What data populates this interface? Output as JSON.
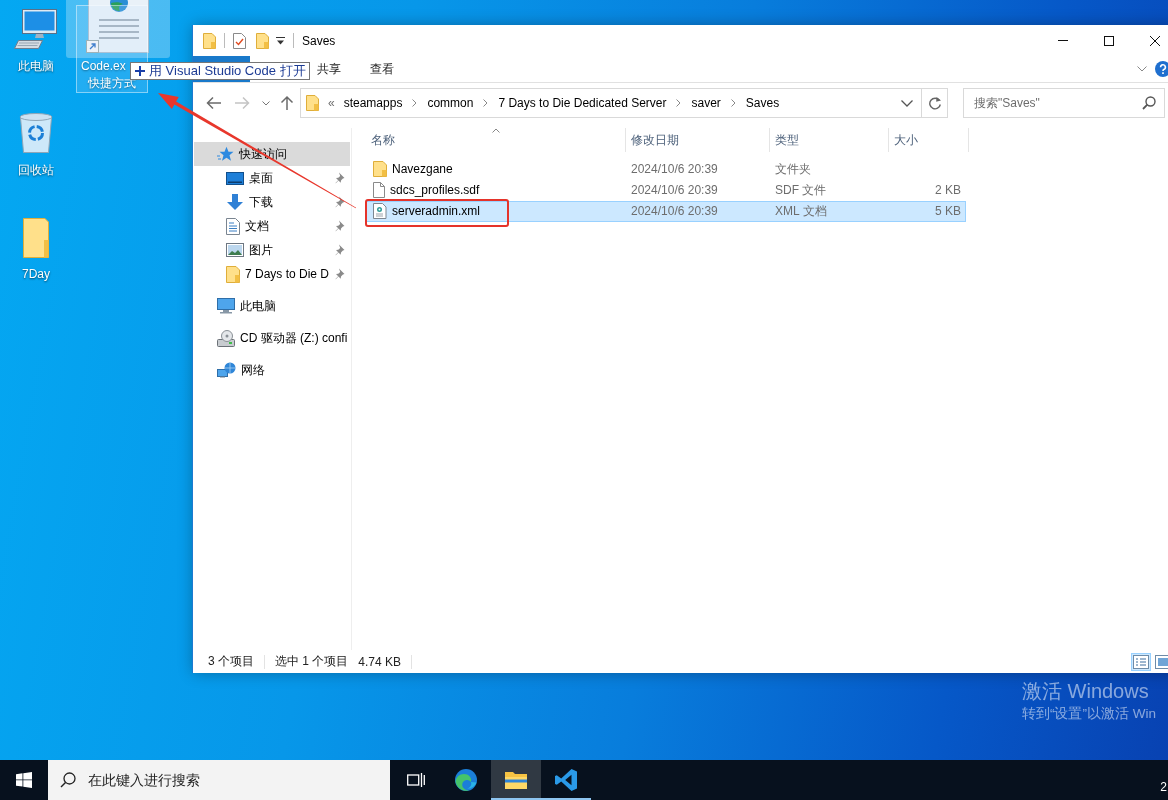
{
  "desktop": {
    "icons": [
      {
        "kind": "computer",
        "label": "此电脑"
      },
      {
        "kind": "recycle-bin",
        "label": "回收站"
      },
      {
        "kind": "folder",
        "label": "7Day"
      }
    ],
    "drag_item": {
      "label_lines": [
        "Code.ex",
        "快捷方式"
      ],
      "tooltip": "用 Visual Studio Code 打开"
    },
    "activation": {
      "title": "激活 Windows",
      "hint": "转到“设置”以激活 Win"
    }
  },
  "explorer": {
    "title": "Saves",
    "ribbon_tabs": [
      {
        "label": "共享",
        "selected": false
      },
      {
        "label": "查看",
        "selected": false
      }
    ],
    "history": {
      "can_go_back": true,
      "can_go_forward": false
    },
    "address": {
      "overflow": "«",
      "crumbs": [
        "steamapps",
        "common",
        "7 Days to Die Dedicated Server",
        "saver",
        "Saves"
      ]
    },
    "search": {
      "placeholder": "搜索\"Saves\""
    },
    "nav": [
      {
        "kind": "quick-access",
        "label": "快速访问",
        "selected": true,
        "children": [
          {
            "kind": "desktop",
            "label": "桌面",
            "pinned": true,
            "selected": false
          },
          {
            "kind": "download",
            "label": "下载",
            "pinned": true,
            "selected": false
          },
          {
            "kind": "documents",
            "label": "文档",
            "pinned": true,
            "selected": false
          },
          {
            "kind": "pictures",
            "label": "图片",
            "pinned": true,
            "selected": false
          },
          {
            "kind": "folder",
            "label": "7 Days to Die D",
            "pinned": true,
            "selected": false
          }
        ]
      },
      {
        "kind": "computer",
        "label": "此电脑",
        "selected": false
      },
      {
        "kind": "cd-drive",
        "label": "CD 驱动器 (Z:) confi",
        "selected": false
      },
      {
        "kind": "network",
        "label": "网络",
        "selected": false
      }
    ],
    "files": {
      "columns": [
        {
          "label": "名称",
          "sorted": true
        },
        {
          "label": "修改日期",
          "sorted": false
        },
        {
          "label": "类型",
          "sorted": false
        },
        {
          "label": "大小",
          "sorted": false
        }
      ],
      "rows": [
        {
          "kind": "folder",
          "name": "Navezgane",
          "modified": "2024/10/6 20:39",
          "type": "文件夹",
          "selected": false,
          "highlighted": false
        },
        {
          "kind": "file",
          "name": "sdcs_profiles.sdf",
          "modified": "2024/10/6 20:39",
          "type": "SDF 文件",
          "size": "2 KB",
          "selected": false,
          "highlighted": false
        },
        {
          "kind": "xml",
          "name": "serveradmin.xml",
          "modified": "2024/10/6 20:39",
          "type": "XML 文档",
          "size": "5 KB",
          "selected": true,
          "highlighted": true
        }
      ]
    },
    "status_bar": {
      "item_count": "3 个项目",
      "selection": "选中 1 个项目",
      "selection_size": "4.74 KB"
    },
    "view_buttons": [
      {
        "kind": "details",
        "selected": true
      },
      {
        "kind": "large-icons",
        "selected": false
      }
    ]
  },
  "taskbar": {
    "search": {
      "placeholder": "在此键入进行搜索"
    },
    "apps": [
      {
        "kind": "task-view",
        "running": false,
        "selected": false
      },
      {
        "kind": "edge",
        "running": false,
        "selected": false
      },
      {
        "kind": "explorer",
        "running": true,
        "selected": true
      },
      {
        "kind": "vscode",
        "running": true,
        "selected": false
      }
    ],
    "clock": "2"
  }
}
